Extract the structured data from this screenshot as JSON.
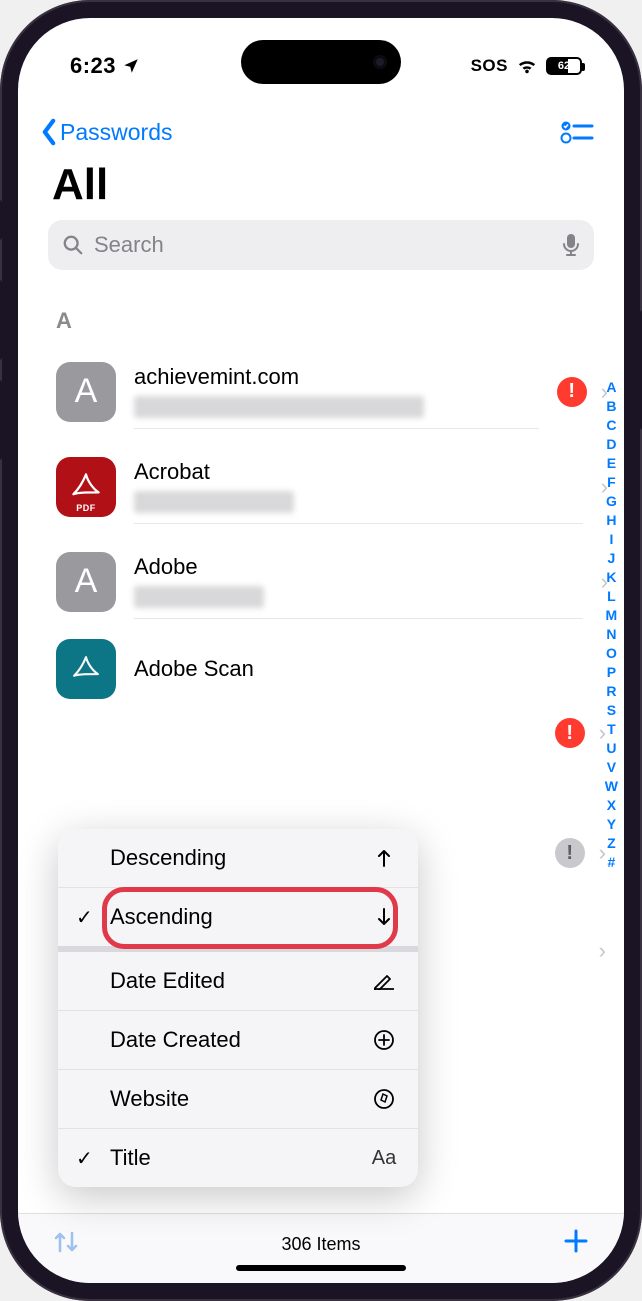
{
  "status": {
    "time": "6:23",
    "sos": "SOS",
    "battery_pct": 62
  },
  "nav": {
    "back_label": "Passwords"
  },
  "title": "All",
  "search": {
    "placeholder": "Search"
  },
  "section_header": "A",
  "rows": [
    {
      "title": "achievemint.com",
      "icon_letter": "A",
      "alert": "red"
    },
    {
      "title": "Acrobat",
      "pdf_label": "PDF"
    },
    {
      "title": "Adobe",
      "icon_letter": "A"
    },
    {
      "title": "Adobe Scan"
    }
  ],
  "hidden_alerts": {
    "a": "red",
    "b": "gray"
  },
  "index_letters": [
    "A",
    "B",
    "C",
    "D",
    "E",
    "F",
    "G",
    "H",
    "I",
    "J",
    "K",
    "L",
    "M",
    "N",
    "O",
    "P",
    "R",
    "S",
    "T",
    "U",
    "V",
    "W",
    "X",
    "Y",
    "Z",
    "#"
  ],
  "menu": {
    "descending": "Descending",
    "ascending": "Ascending",
    "date_edited": "Date Edited",
    "date_created": "Date Created",
    "website": "Website",
    "title": "Title"
  },
  "toolbar": {
    "count": "306 Items"
  }
}
